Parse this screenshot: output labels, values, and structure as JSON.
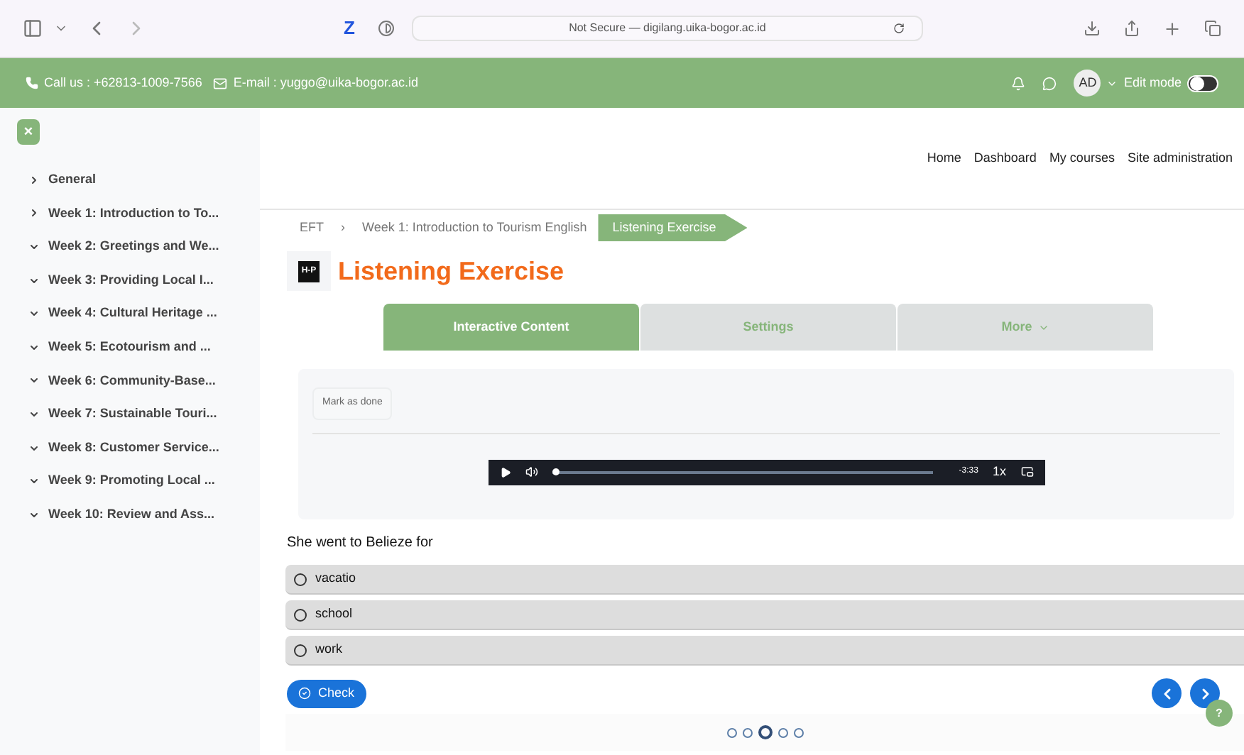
{
  "browser": {
    "address": "Not Secure — digilang.uika-bogor.ac.id",
    "z_label": "Z"
  },
  "topbar": {
    "phone": "Call us : +62813-1009-7566",
    "email": "E-mail : yuggo@uika-bogor.ac.id",
    "avatar": "AD",
    "edit_mode": {
      "label": "Edit mode",
      "on": false
    }
  },
  "sidebar": {
    "close": "×",
    "items": [
      {
        "label": "General",
        "expanded": false
      },
      {
        "label": "Week 1: Introduction to To...",
        "expanded": false
      },
      {
        "label": "Week 2: Greetings and We...",
        "expanded": true
      },
      {
        "label": "Week 3: Providing Local I...",
        "expanded": true
      },
      {
        "label": "Week 4: Cultural Heritage ...",
        "expanded": true
      },
      {
        "label": "Week 5: Ecotourism and ...",
        "expanded": true
      },
      {
        "label": "Week 6: Community-Base...",
        "expanded": true
      },
      {
        "label": "Week 7: Sustainable Touri...",
        "expanded": true
      },
      {
        "label": "Week 8: Customer Service...",
        "expanded": true
      },
      {
        "label": "Week 9: Promoting Local ...",
        "expanded": true
      },
      {
        "label": "Week 10: Review and Ass...",
        "expanded": true
      }
    ]
  },
  "nav": [
    "Home",
    "Dashboard",
    "My courses",
    "Site administration"
  ],
  "breadcrumb_separator": "›",
  "breadcrumb": [
    {
      "label": "EFT",
      "selected": false
    },
    {
      "label": "Week 1: Introduction to Tourism English",
      "selected": false
    },
    {
      "label": "Listening Exercise",
      "selected": true
    }
  ],
  "logo": "H-P",
  "title": "Listening Exercise",
  "tabs": [
    {
      "label": "Interactive Content",
      "selected": true
    },
    {
      "label": "Settings",
      "selected": false
    },
    {
      "label": "More",
      "selected": false
    }
  ],
  "mark_done": "Mark as done",
  "player": {
    "time": "-3:33",
    "speed": "1x",
    "level": 0.0
  },
  "question": "She went to Belieze for",
  "options": [
    {
      "label": "vacatio",
      "selected": false
    },
    {
      "label": "school",
      "selected": false
    },
    {
      "label": "work",
      "selected": false
    }
  ],
  "check": "Check",
  "pager": [
    {
      "selected": false
    },
    {
      "selected": false
    },
    {
      "selected": true
    },
    {
      "selected": false
    },
    {
      "selected": false
    }
  ],
  "help": "?"
}
